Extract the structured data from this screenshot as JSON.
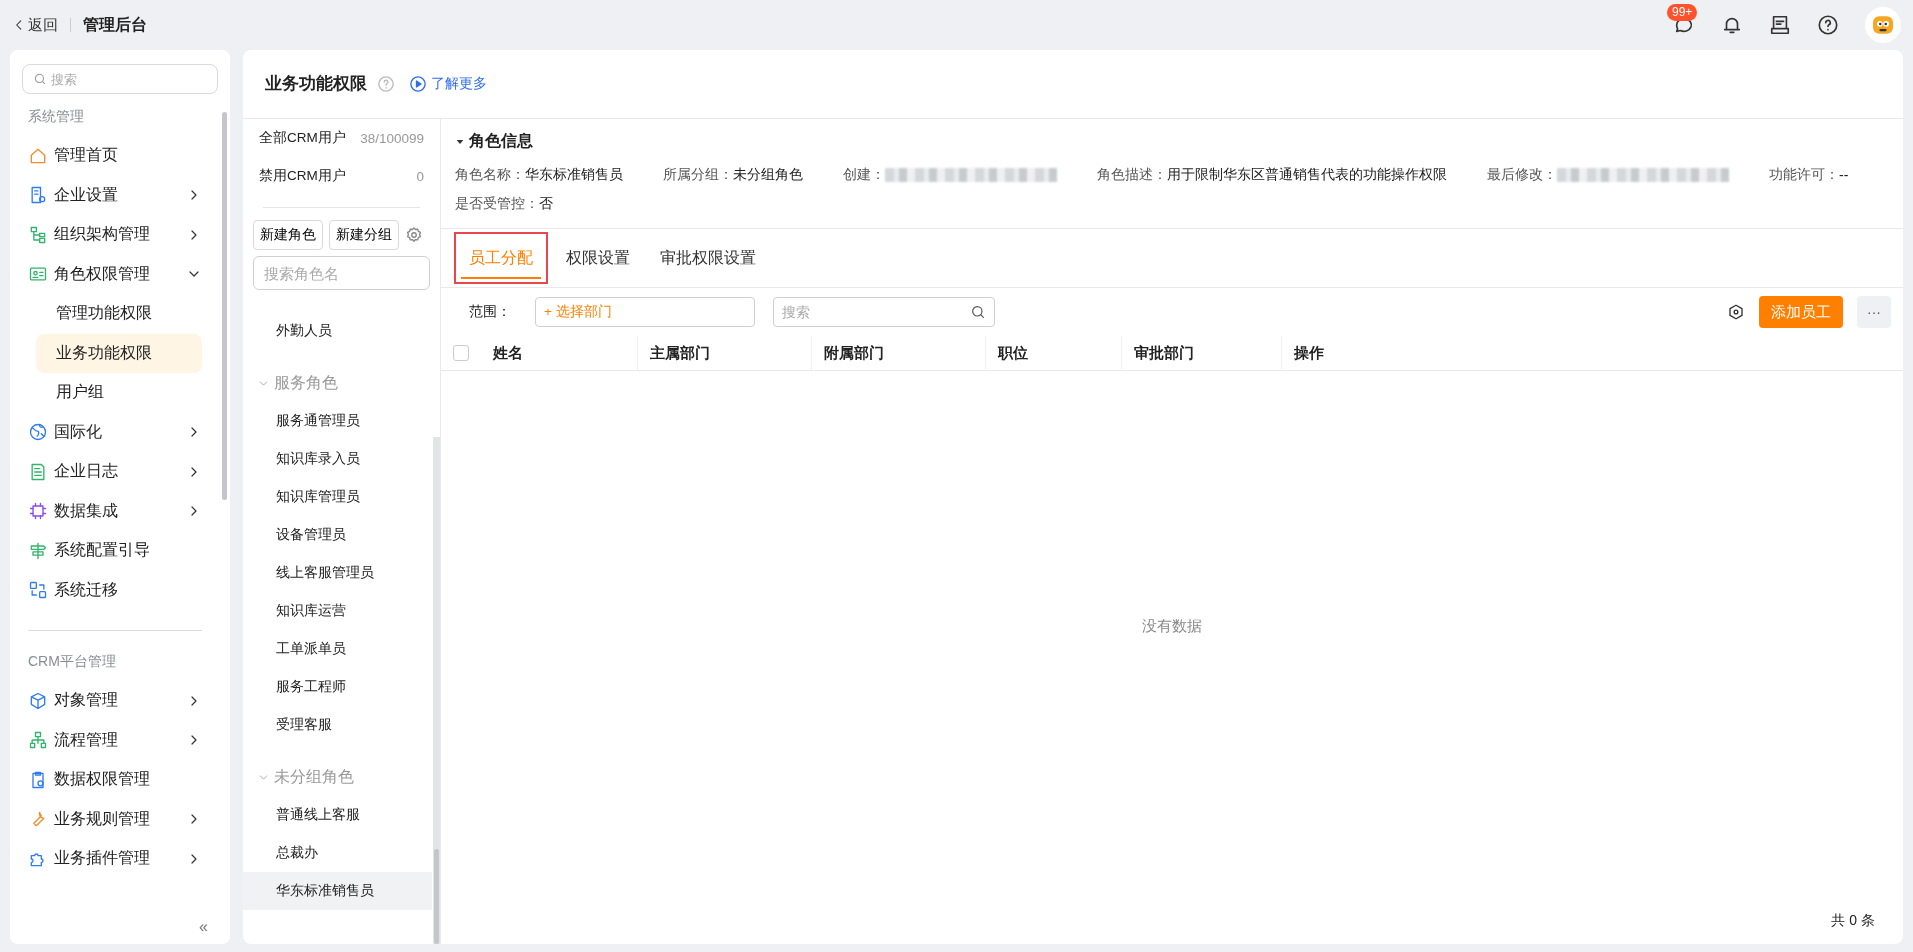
{
  "header": {
    "back": "返回",
    "title": "管理后台",
    "message_badge": "99+"
  },
  "sidebar": {
    "search_placeholder": "搜索",
    "sections": [
      {
        "title": "系统管理",
        "items": [
          {
            "label": "管理首页",
            "kind": "link"
          },
          {
            "label": "企业设置",
            "kind": "group",
            "expanded": false
          },
          {
            "label": "组织架构管理",
            "kind": "group",
            "expanded": false
          },
          {
            "label": "角色权限管理",
            "kind": "group",
            "expanded": true,
            "children": [
              {
                "label": "管理功能权限",
                "selected": false
              },
              {
                "label": "业务功能权限",
                "selected": true
              },
              {
                "label": "用户组",
                "selected": false
              }
            ]
          },
          {
            "label": "国际化",
            "kind": "group",
            "expanded": false
          },
          {
            "label": "企业日志",
            "kind": "group",
            "expanded": false
          },
          {
            "label": "数据集成",
            "kind": "group",
            "expanded": false
          },
          {
            "label": "系统配置引导",
            "kind": "link"
          },
          {
            "label": "系统迁移",
            "kind": "link"
          }
        ]
      },
      {
        "title": "CRM平台管理",
        "items": [
          {
            "label": "对象管理",
            "kind": "group",
            "expanded": false
          },
          {
            "label": "流程管理",
            "kind": "group",
            "expanded": false
          },
          {
            "label": "数据权限管理",
            "kind": "link"
          },
          {
            "label": "业务规则管理",
            "kind": "group",
            "expanded": false
          },
          {
            "label": "业务插件管理",
            "kind": "group",
            "expanded": false
          }
        ]
      }
    ],
    "collapse": "«"
  },
  "page": {
    "title": "业务功能权限",
    "learn_more": "了解更多"
  },
  "role_panel": {
    "counts": [
      {
        "label": "全部CRM用户",
        "value": "38/100099"
      },
      {
        "label": "禁用CRM用户",
        "value": "0"
      }
    ],
    "buttons": [
      "新建角色",
      "新建分组"
    ],
    "search_placeholder": "搜索角色名",
    "leading_roles": [
      {
        "label": "外勤人员",
        "selected": false
      }
    ],
    "groups": [
      {
        "label": "服务角色",
        "expanded": true,
        "roles": [
          {
            "label": "服务通管理员",
            "selected": false
          },
          {
            "label": "知识库录入员",
            "selected": false
          },
          {
            "label": "知识库管理员",
            "selected": false
          },
          {
            "label": "设备管理员",
            "selected": false
          },
          {
            "label": "线上客服管理员",
            "selected": false
          },
          {
            "label": "知识库运营",
            "selected": false
          },
          {
            "label": "工单派单员",
            "selected": false
          },
          {
            "label": "服务工程师",
            "selected": false
          },
          {
            "label": "受理客服",
            "selected": false
          }
        ]
      },
      {
        "label": "未分组角色",
        "expanded": true,
        "roles": [
          {
            "label": "普通线上客服",
            "selected": false
          },
          {
            "label": "总裁办",
            "selected": false
          },
          {
            "label": "华东标准销售员",
            "selected": true
          }
        ]
      }
    ]
  },
  "role_info": {
    "title": "角色信息",
    "expanded": true,
    "rows": [
      [
        {
          "label": "角色名称：",
          "value": "华东标准销售员",
          "redacted": false
        },
        {
          "label": "所属分组：",
          "value": "未分组角色",
          "redacted": false
        },
        {
          "label": "创建：",
          "redacted": true
        },
        {
          "label": "角色描述：",
          "value": "用于限制华东区普通销售代表的功能操作权限",
          "redacted": false
        },
        {
          "label": "最后修改：",
          "redacted": true
        },
        {
          "label": "功能许可：",
          "value": "--",
          "redacted": false
        }
      ],
      [
        {
          "label": "是否受管控：",
          "value": "否",
          "redacted": false
        }
      ]
    ]
  },
  "tabs": [
    {
      "label": "员工分配",
      "selected": true,
      "highlighted": true
    },
    {
      "label": "权限设置",
      "selected": false,
      "highlighted": false
    },
    {
      "label": "审批权限设置",
      "selected": false,
      "highlighted": false
    }
  ],
  "toolbar": {
    "scope_label": "范围：",
    "department_picker": "+ 选择部门",
    "search_placeholder": "搜索",
    "add_button": "添加员工",
    "more_button": "···"
  },
  "table": {
    "select_all_checked": false,
    "columns": [
      "姓名",
      "主属部门",
      "附属部门",
      "职位",
      "审批部门",
      "操作"
    ],
    "empty_text": "没有数据",
    "footer": "共 0 条"
  }
}
